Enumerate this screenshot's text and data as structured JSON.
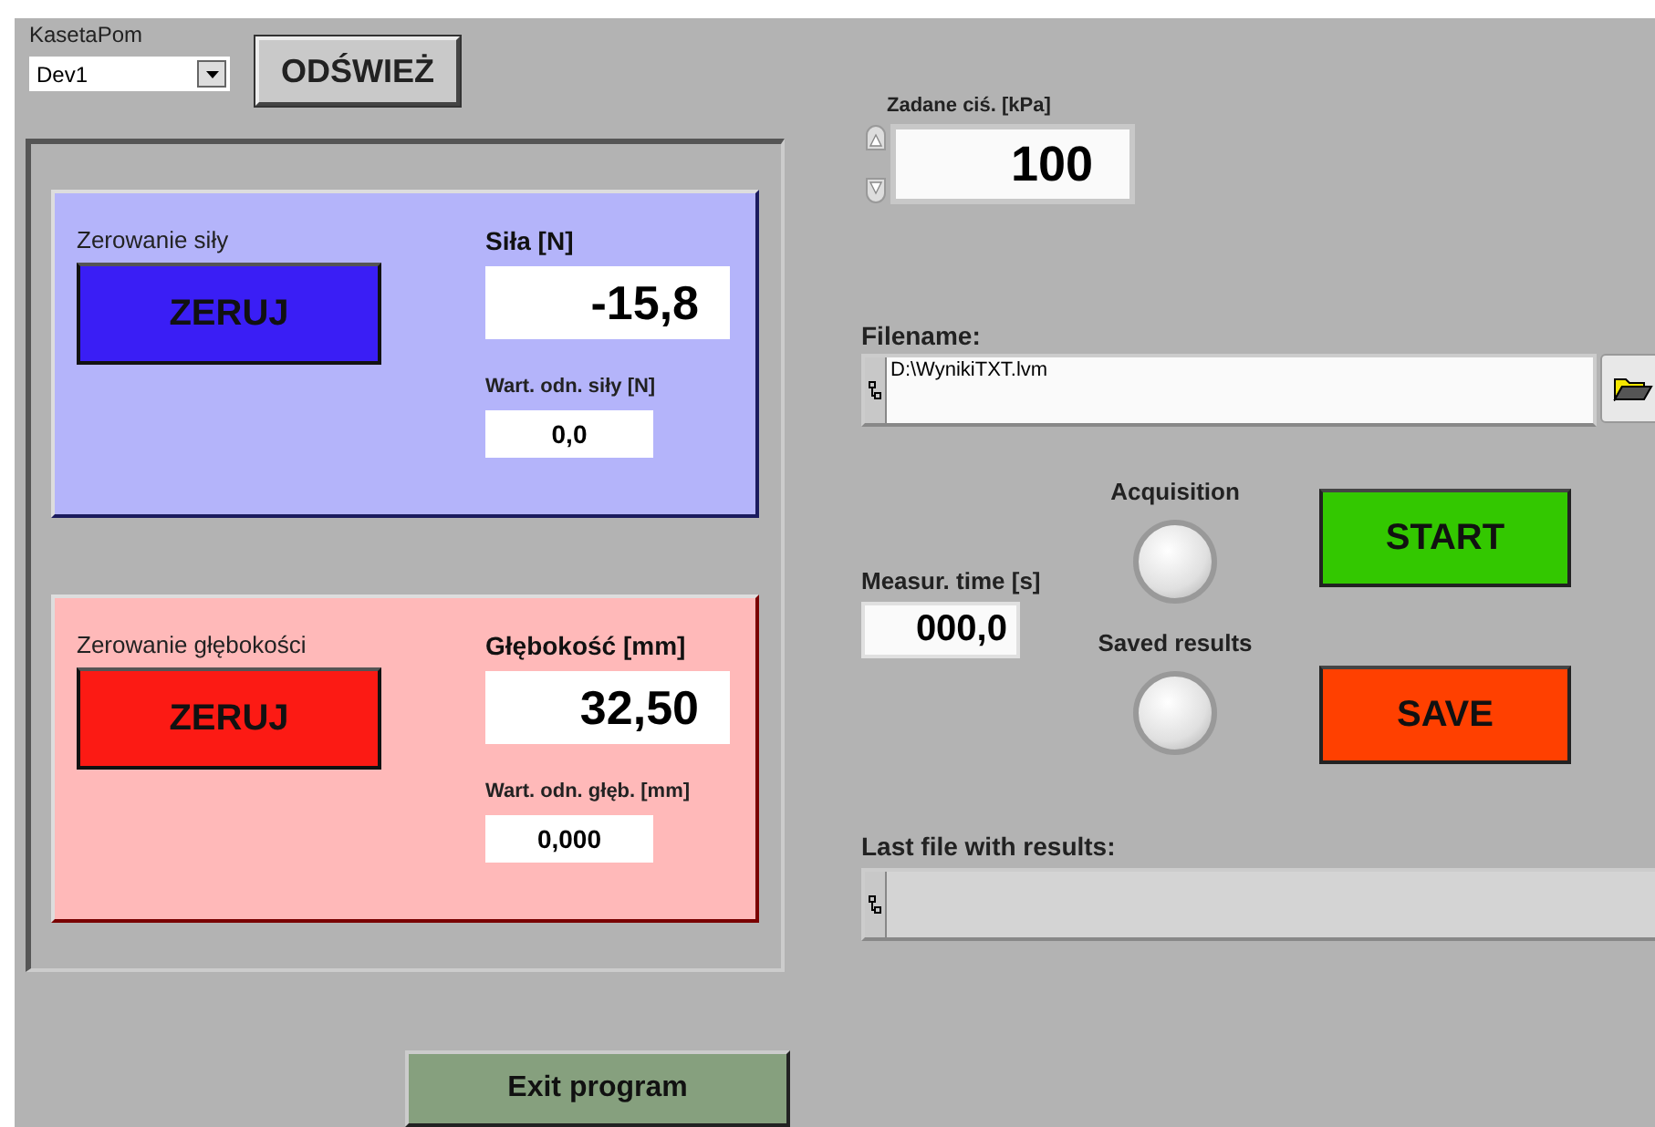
{
  "device_selector": {
    "label": "KasetaPom",
    "value": "Dev1"
  },
  "refresh_button": "ODŚWIEŻ",
  "panels": [
    {
      "title": "Zerowanie siły",
      "button": {
        "label": "ZERUJ",
        "color": "#3a1ef5"
      },
      "color": "#b4b4fa",
      "reading_label": "Siła [N]",
      "reading": "-15,8",
      "ref_label": "Wart. odn. siły [N]",
      "ref_value": "0,0"
    },
    {
      "title": "Zerowanie głębokości",
      "button": {
        "label": "ZERUJ",
        "color": "#fc1a14"
      },
      "color": "#ffb9b9",
      "reading_label": "Głębokość [mm]",
      "reading": "32,50",
      "ref_label": "Wart. odn. głęb. [mm]",
      "ref_value": "0,000"
    }
  ],
  "exit_button": "Exit program",
  "pressure": {
    "label": "Zadane ciś. [kPa]",
    "value": "100"
  },
  "filename": {
    "label": "Filename:",
    "value": "D:\\WynikiTXT.lvm"
  },
  "measurement_time": {
    "label": "Measur. time [s]",
    "value": "000,0"
  },
  "indicators": [
    {
      "label": "Acquisition",
      "on": false
    },
    {
      "label": "Saved results",
      "on": false
    }
  ],
  "action_buttons": [
    {
      "label": "START",
      "color": "#33c800"
    },
    {
      "label": "SAVE",
      "color": "#ff4000"
    }
  ],
  "last_file": {
    "label": "Last file with results:"
  }
}
